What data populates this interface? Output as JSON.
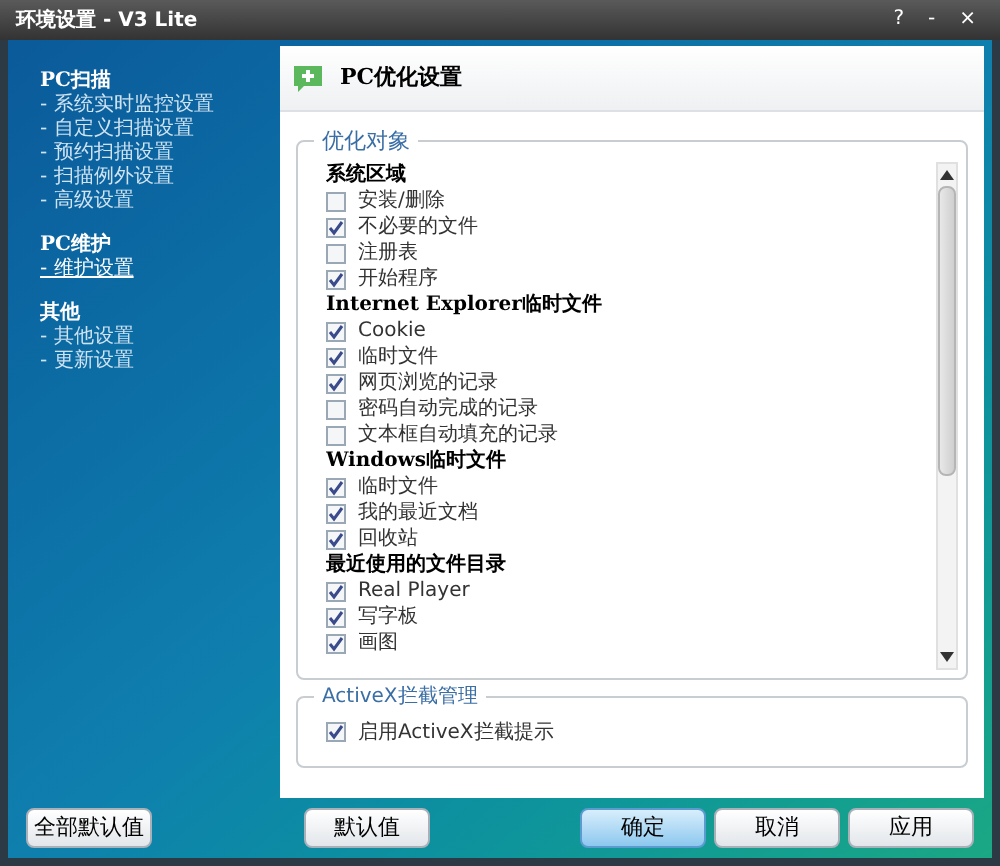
{
  "window": {
    "title": "环境设置 - V3 Lite",
    "controls": [
      "?",
      "-",
      "×"
    ]
  },
  "sidebar": {
    "sections": [
      {
        "title": "PC扫描",
        "items": [
          {
            "label": "- 系统实时监控设置",
            "selected": false
          },
          {
            "label": "- 自定义扫描设置",
            "selected": false
          },
          {
            "label": "- 预约扫描设置",
            "selected": false
          },
          {
            "label": "- 扫描例外设置",
            "selected": false
          },
          {
            "label": "- 高级设置",
            "selected": false
          }
        ]
      },
      {
        "title": "PC维护",
        "items": [
          {
            "label": "- 维护设置",
            "selected": true
          }
        ]
      },
      {
        "title": "其他",
        "items": [
          {
            "label": "- 其他设置",
            "selected": false
          },
          {
            "label": "- 更新设置",
            "selected": false
          }
        ]
      }
    ]
  },
  "panel": {
    "title": "PC优化设置",
    "targets": {
      "legend": "优化对象",
      "entries": [
        {
          "kind": "header",
          "label": "系统区域"
        },
        {
          "kind": "checkbox",
          "label": "安装/删除",
          "checked": false
        },
        {
          "kind": "checkbox",
          "label": "不必要的文件",
          "checked": true
        },
        {
          "kind": "checkbox",
          "label": "注册表",
          "checked": false
        },
        {
          "kind": "checkbox",
          "label": "开始程序",
          "checked": true
        },
        {
          "kind": "header",
          "label": "Internet Explorer临时文件"
        },
        {
          "kind": "checkbox",
          "label": "Cookie",
          "checked": true
        },
        {
          "kind": "checkbox",
          "label": "临时文件",
          "checked": true
        },
        {
          "kind": "checkbox",
          "label": "网页浏览的记录",
          "checked": true
        },
        {
          "kind": "checkbox",
          "label": "密码自动完成的记录",
          "checked": false
        },
        {
          "kind": "checkbox",
          "label": "文本框自动填充的记录",
          "checked": false
        },
        {
          "kind": "header",
          "label": "Windows临时文件"
        },
        {
          "kind": "checkbox",
          "label": "临时文件",
          "checked": true
        },
        {
          "kind": "checkbox",
          "label": "我的最近文档",
          "checked": true
        },
        {
          "kind": "checkbox",
          "label": "回收站",
          "checked": true
        },
        {
          "kind": "header",
          "label": "最近使用的文件目录"
        },
        {
          "kind": "checkbox",
          "label": "Real Player",
          "checked": true
        },
        {
          "kind": "checkbox",
          "label": "写字板",
          "checked": true
        },
        {
          "kind": "checkbox",
          "label": "画图",
          "checked": true
        }
      ]
    },
    "activex": {
      "legend": "ActiveX拦截管理",
      "option": {
        "label": "启用ActiveX拦截提示",
        "checked": true
      }
    }
  },
  "buttons": [
    {
      "label": "全部默认值",
      "primary": false
    },
    {
      "label": "默认值",
      "primary": false
    },
    {
      "label": "确定",
      "primary": true
    },
    {
      "label": "取消",
      "primary": false
    },
    {
      "label": "应用",
      "primary": false
    }
  ]
}
